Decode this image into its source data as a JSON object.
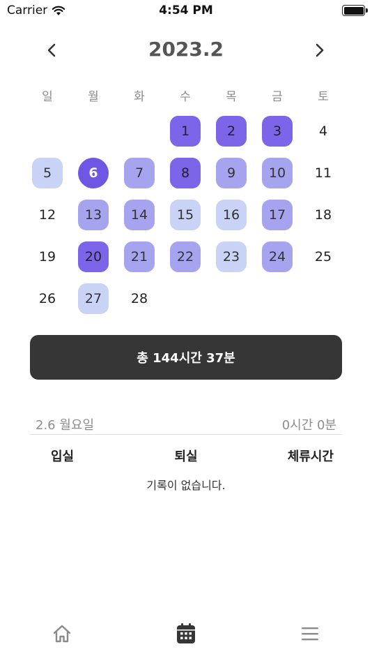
{
  "status_bar": {
    "carrier": "Carrier",
    "time": "4:54 PM"
  },
  "header": {
    "title": "2023.2",
    "prev_icon": "chevron-left-icon",
    "next_icon": "chevron-right-icon"
  },
  "weekdays": [
    "일",
    "월",
    "화",
    "수",
    "목",
    "금",
    "토"
  ],
  "days": [
    {
      "label": "",
      "level": 0
    },
    {
      "label": "",
      "level": 0
    },
    {
      "label": "",
      "level": 0
    },
    {
      "label": "1",
      "level": 3
    },
    {
      "label": "2",
      "level": 3
    },
    {
      "label": "3",
      "level": 3
    },
    {
      "label": "4",
      "level": 0
    },
    {
      "label": "5",
      "level": 1
    },
    {
      "label": "6",
      "level": 3,
      "selected": true
    },
    {
      "label": "7",
      "level": 2
    },
    {
      "label": "8",
      "level": 3
    },
    {
      "label": "9",
      "level": 2
    },
    {
      "label": "10",
      "level": 2
    },
    {
      "label": "11",
      "level": 0
    },
    {
      "label": "12",
      "level": 0
    },
    {
      "label": "13",
      "level": 2
    },
    {
      "label": "14",
      "level": 2
    },
    {
      "label": "15",
      "level": 1
    },
    {
      "label": "16",
      "level": 1
    },
    {
      "label": "17",
      "level": 2
    },
    {
      "label": "18",
      "level": 0
    },
    {
      "label": "19",
      "level": 0
    },
    {
      "label": "20",
      "level": 3
    },
    {
      "label": "21",
      "level": 2
    },
    {
      "label": "22",
      "level": 2
    },
    {
      "label": "23",
      "level": 1
    },
    {
      "label": "24",
      "level": 2
    },
    {
      "label": "25",
      "level": 0
    },
    {
      "label": "26",
      "level": 0
    },
    {
      "label": "27",
      "level": 1
    },
    {
      "label": "28",
      "level": 0
    }
  ],
  "total": {
    "label": "총 144시간 37분"
  },
  "record": {
    "date": "2.6 월요일",
    "duration": "0시간 0분",
    "columns": {
      "entry": "입실",
      "exit": "퇴실",
      "stay": "체류시간"
    },
    "empty_message": "기록이 없습니다."
  },
  "tabbar": {
    "items": [
      "home-icon",
      "calendar-icon",
      "menu-icon"
    ],
    "active": "calendar-icon"
  },
  "colors": {
    "level1": "#c9d3f5",
    "level2": "#a6a3ef",
    "level3": "#7c65e8",
    "selected": "#6f56e3",
    "total_bg": "#363636"
  }
}
